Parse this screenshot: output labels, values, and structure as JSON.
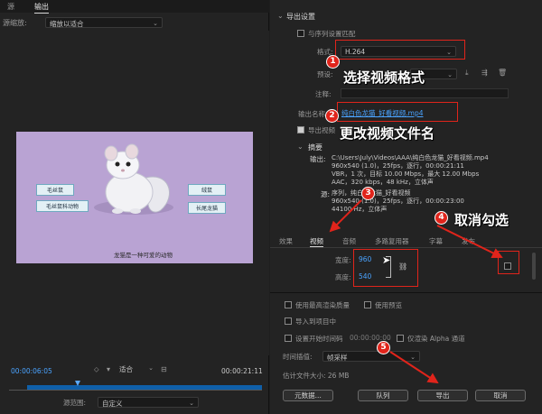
{
  "left": {
    "tabs": [
      "源",
      "输出"
    ],
    "source_scale_label": "源缩放:",
    "source_scale_value": "缩放以适合",
    "video_labels": [
      "毛丝鼠",
      "毛丝鼠科动物",
      "绒鼠",
      "长尾龙猫"
    ],
    "video_caption": "龙猫是一种可爱的动物",
    "time_start": "00:00:06:05",
    "fit_value": "适合",
    "time_end": "00:00:21:11",
    "source_range_label": "源范围:",
    "source_range_value": "自定义"
  },
  "right": {
    "section_title": "导出设置",
    "match_sequence_label": "与序列设置匹配",
    "format_label": "格式:",
    "format_value": "H.264",
    "preset_label": "预设:",
    "comment_label": "注释:",
    "output_name_label": "输出名称:",
    "output_name_value": "纯白色龙猫_好看视频.mp4",
    "export_video_label": "导出视频",
    "summary_title": "摘要",
    "output_label": "输出:",
    "output_lines": [
      "C:\\Users\\July\\Videos\\AAA\\纯白色龙猫_好看视频.mp4",
      "960x540 (1.0)，25fps，逐行，00:00:21:11",
      "VBR，1 次，目标 10.00 Mbps，最大 12.00 Mbps",
      "AAC，320 kbps，48 kHz，立体声"
    ],
    "source_label": "源:",
    "source_lines": [
      "序列，纯白色龙猫_好看视频",
      "960x540 (1.0)，25fps，逐行，00:00:23:00",
      "44100 Hz，立体声"
    ],
    "tabs": [
      "效果",
      "视频",
      "音频",
      "多路复用器",
      "字幕",
      "发布"
    ],
    "width_label": "宽度:",
    "width_value": "960",
    "height_label": "高度:",
    "height_value": "540",
    "opt_max_render": "使用最高渲染质量",
    "opt_preview": "使用预览",
    "opt_import": "导入到项目中",
    "opt_start_tc": "设置开始时间码",
    "opt_start_tc_value": "00:00:00:00",
    "opt_alpha": "仅渲染 Alpha 通道",
    "time_interp_label": "时间插值:",
    "time_interp_value": "帧采样",
    "file_size": "估计文件大小: 26 MB",
    "btn_metadata": "元数据...",
    "btn_queue": "队列",
    "btn_export": "导出",
    "btn_cancel": "取消"
  },
  "annotations": {
    "a1_num": "1",
    "a1_text": "选择视频格式",
    "a2_num": "2",
    "a2_text": "更改视频文件名",
    "a3_num": "3",
    "a4_num": "4",
    "a4_text": "取消勾选",
    "a5_num": "5"
  },
  "colors": {
    "annotation_red": "#e0241b",
    "timecode_blue": "#4aa3ff"
  }
}
